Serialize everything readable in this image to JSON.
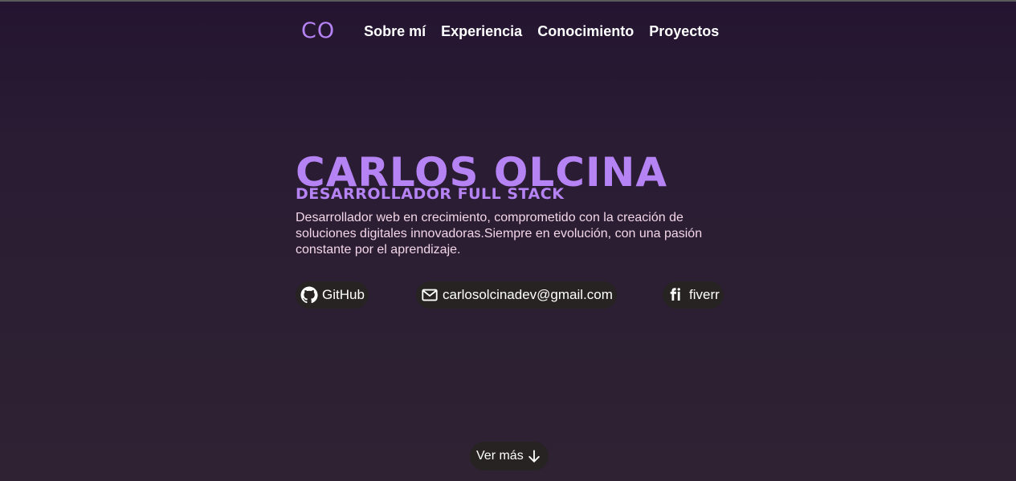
{
  "nav": {
    "logo": "CO",
    "links": [
      {
        "label": "Sobre mí"
      },
      {
        "label": "Experiencia"
      },
      {
        "label": "Conocimiento"
      },
      {
        "label": "Proyectos"
      }
    ]
  },
  "hero": {
    "name": "CARLOS OLCINA",
    "role": "DESARROLLADOR FULL STACK",
    "description": "Desarrollador web en crecimiento, comprometido con la creación de soluciones digitales innovadoras.Siempre en evolución, con una pasión constante por el aprendizaje."
  },
  "socials": {
    "github": {
      "label": "GitHub",
      "icon": "github-icon"
    },
    "email": {
      "label": "carlosolcinadev@gmail.com",
      "icon": "mail-icon"
    },
    "fiverr": {
      "label": "fiverr",
      "icon": "fiverr-icon"
    }
  },
  "more": {
    "label": "Ver más",
    "icon": "arrow-down-icon"
  },
  "colors": {
    "accent": "#b683f5",
    "pill_bg": "#262322",
    "description_text": "#f3d6e8"
  }
}
